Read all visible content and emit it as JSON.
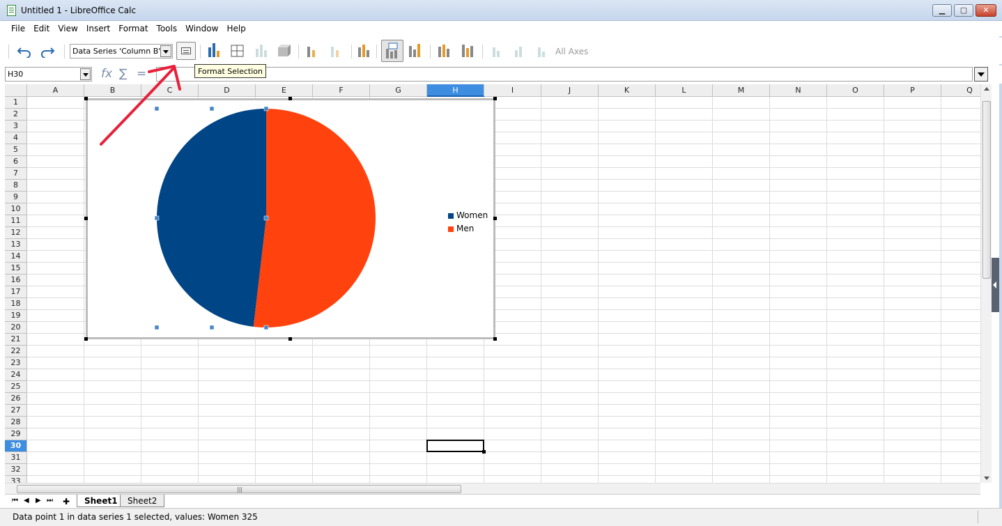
{
  "window": {
    "title": "Untitled 1 - LibreOffice Calc",
    "minimize": "▁",
    "maximize": "▢",
    "close": "✕"
  },
  "menu": [
    "File",
    "Edit",
    "View",
    "Insert",
    "Format",
    "Tools",
    "Window",
    "Help"
  ],
  "toolbar": {
    "series_select": "Data Series 'Column B' D",
    "all_axes": "All Axes",
    "tooltip": "Format Selection"
  },
  "formula_bar": {
    "name_box": "H30",
    "fx": "fx",
    "sum": "∑",
    "equals": "="
  },
  "columns": [
    "A",
    "B",
    "C",
    "D",
    "E",
    "F",
    "G",
    "H",
    "I",
    "J",
    "K",
    "L",
    "M",
    "N",
    "O",
    "P",
    "Q"
  ],
  "active_column": "H",
  "rows": [
    "1",
    "2",
    "3",
    "4",
    "5",
    "6",
    "7",
    "8",
    "9",
    "10",
    "11",
    "12",
    "13",
    "14",
    "15",
    "16",
    "17",
    "18",
    "19",
    "20",
    "21",
    "22",
    "23",
    "24",
    "25",
    "26",
    "27",
    "28",
    "29",
    "30",
    "31",
    "32",
    "33"
  ],
  "active_row": "30",
  "chart_data": {
    "type": "pie",
    "categories": [
      "Women",
      "Men"
    ],
    "values": [
      325,
      350
    ],
    "colors": [
      "#004586",
      "#ff420e"
    ],
    "legend": "right"
  },
  "sheets": {
    "tabs": [
      "Sheet1",
      "Sheet2"
    ],
    "active": "Sheet1",
    "add": "✚"
  },
  "status": {
    "text": "Data point 1 in data series 1 selected, values: Women 325"
  },
  "colors": {
    "annotation_arrow": "#e8203a",
    "active_header": "#3d8de0"
  }
}
